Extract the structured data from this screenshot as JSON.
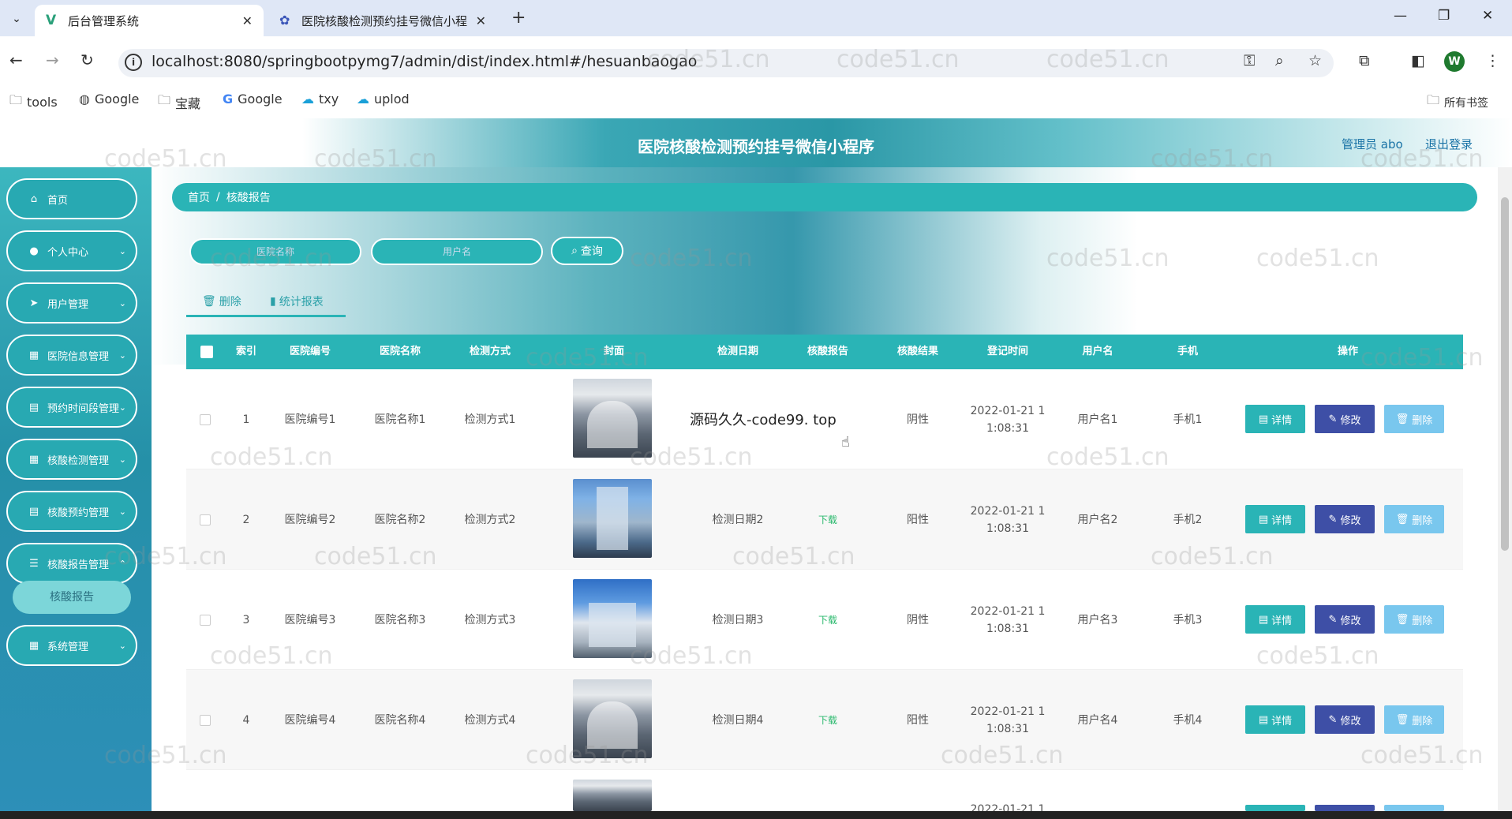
{
  "browser": {
    "tabs": [
      {
        "title": "后台管理系统",
        "close": "✕"
      },
      {
        "title": "医院核酸检测预约挂号微信小程",
        "close": "✕"
      }
    ],
    "new_tab": "+",
    "url": "localhost:8080/springbootpymg7/admin/dist/index.html#/hesuanbaogao",
    "bookmarks": [
      "tools",
      "Google",
      "宝藏",
      "Google",
      "txy",
      "uplod"
    ],
    "all_bookmarks": "所有书签",
    "profile_initial": "W"
  },
  "header": {
    "title": "医院核酸检测预约挂号微信小程序",
    "admin": "管理员 abo",
    "logout": "退出登录"
  },
  "sidebar": {
    "items": [
      {
        "label": "首页",
        "icon": "home-icon"
      },
      {
        "label": "个人中心",
        "icon": "user-icon"
      },
      {
        "label": "用户管理",
        "icon": "send-icon"
      },
      {
        "label": "医院信息管理",
        "icon": "grid-icon"
      },
      {
        "label": "预约时间段管理",
        "icon": "doc-icon"
      },
      {
        "label": "核酸检测管理",
        "icon": "grid-icon"
      },
      {
        "label": "核酸预约管理",
        "icon": "doc-icon"
      },
      {
        "label": "核酸报告管理",
        "icon": "sliders-icon"
      },
      {
        "label": "系统管理",
        "icon": "grid-icon"
      }
    ],
    "active_sub": "核酸报告"
  },
  "breadcrumb": {
    "home": "首页",
    "sep": "/",
    "current": "核酸报告"
  },
  "search": {
    "hospital_name_placeholder": "医院名称",
    "username_placeholder": "用户名",
    "button": "查询"
  },
  "actions": {
    "delete": "删除",
    "stats": "统计报表"
  },
  "table": {
    "headers": [
      "索引",
      "医院编号",
      "医院名称",
      "检测方式",
      "封面",
      "检测日期",
      "核酸报告",
      "核酸结果",
      "登记时间",
      "用户名",
      "手机",
      "操作"
    ],
    "rows": [
      {
        "index": "1",
        "hospital_no": "医院编号1",
        "hospital_name": "医院名称1",
        "method": "检测方式1",
        "date": "",
        "report": "",
        "result": "阴性",
        "reg_date": "2022-01-21 1",
        "reg_time": "1:08:31",
        "username": "用户名1",
        "phone": "手机1"
      },
      {
        "index": "2",
        "hospital_no": "医院编号2",
        "hospital_name": "医院名称2",
        "method": "检测方式2",
        "date": "检测日期2",
        "report": "下载",
        "result": "阳性",
        "reg_date": "2022-01-21 1",
        "reg_time": "1:08:31",
        "username": "用户名2",
        "phone": "手机2"
      },
      {
        "index": "3",
        "hospital_no": "医院编号3",
        "hospital_name": "医院名称3",
        "method": "检测方式3",
        "date": "检测日期3",
        "report": "下载",
        "result": "阴性",
        "reg_date": "2022-01-21 1",
        "reg_time": "1:08:31",
        "username": "用户名3",
        "phone": "手机3"
      },
      {
        "index": "4",
        "hospital_no": "医院编号4",
        "hospital_name": "医院名称4",
        "method": "检测方式4",
        "date": "检测日期4",
        "report": "下载",
        "result": "阳性",
        "reg_date": "2022-01-21 1",
        "reg_time": "1:08:31",
        "username": "用户名4",
        "phone": "手机4"
      }
    ],
    "partial_row_reg_date": "2022-01-21 1",
    "buttons": {
      "detail": "详情",
      "edit": "修改",
      "delete": "删除"
    }
  },
  "overlay_text": "源码久久-code99. top",
  "watermark": "code51.cn"
}
